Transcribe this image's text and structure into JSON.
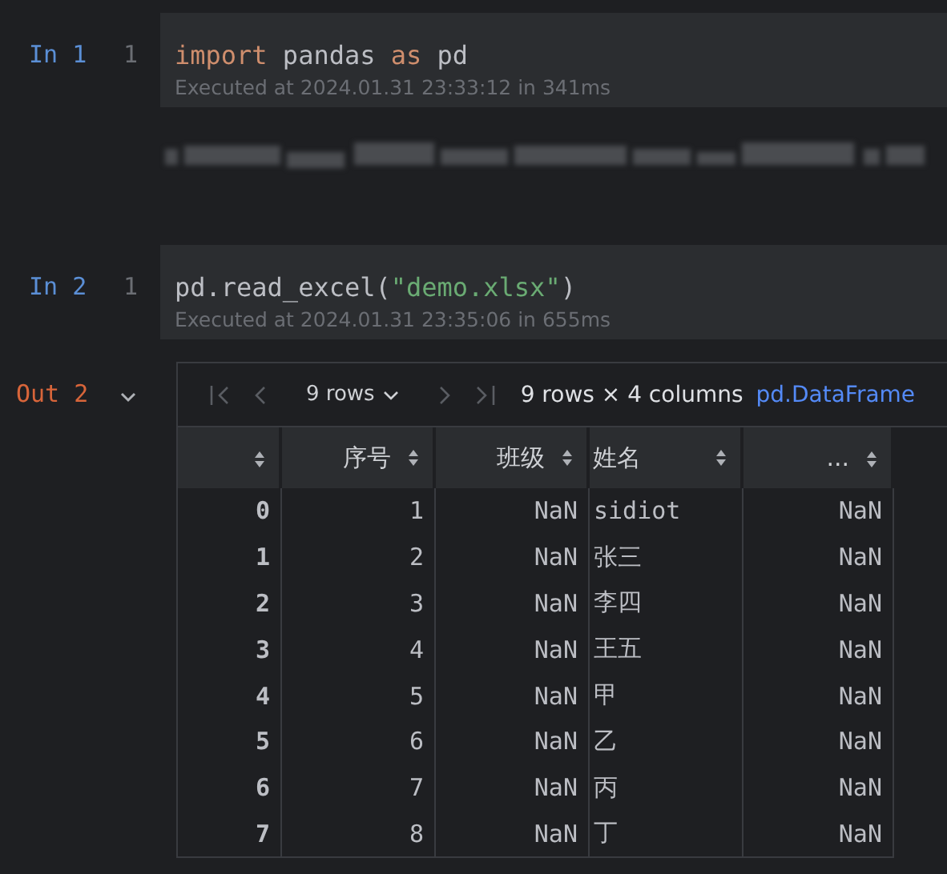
{
  "cells": [
    {
      "prompt": "In 1",
      "line_number": "1",
      "code": [
        {
          "kind": "keyword",
          "text": "import"
        },
        {
          "kind": "plain",
          "text": " pandas "
        },
        {
          "kind": "keyword",
          "text": "as"
        },
        {
          "kind": "plain",
          "text": " pd"
        }
      ],
      "status": "Executed at 2024.01.31 23:33:12 in 341ms",
      "output": {
        "kind": "blurred"
      }
    },
    {
      "prompt": "In 2",
      "line_number": "1",
      "code": [
        {
          "kind": "plain",
          "text": "pd.read_excel("
        },
        {
          "kind": "string",
          "text": "\"demo.xlsx\""
        },
        {
          "kind": "plain",
          "text": ")"
        }
      ],
      "status": "Executed at 2024.01.31 23:35:06 in 655ms"
    }
  ],
  "output": {
    "prompt": "Out 2",
    "expanded": true,
    "toolbar": {
      "nav": [
        {
          "kind": "first",
          "disabled": true
        },
        {
          "kind": "prev",
          "disabled": true
        }
      ],
      "rows_dropdown": "9 rows",
      "nav_after": [
        {
          "kind": "next",
          "disabled": true
        },
        {
          "kind": "last",
          "disabled": true
        }
      ],
      "shape": "9 rows × 4 columns",
      "type_link": "pd.DataFrame"
    },
    "table": {
      "columns": [
        "",
        "序号",
        "班级",
        "姓名",
        "..."
      ],
      "rows": [
        [
          "0",
          "1",
          "NaN",
          "sidiot",
          "NaN"
        ],
        [
          "1",
          "2",
          "NaN",
          "张三",
          "NaN"
        ],
        [
          "2",
          "3",
          "NaN",
          "李四",
          "NaN"
        ],
        [
          "3",
          "4",
          "NaN",
          "王五",
          "NaN"
        ],
        [
          "4",
          "5",
          "NaN",
          "甲",
          "NaN"
        ],
        [
          "5",
          "6",
          "NaN",
          "乙",
          "NaN"
        ],
        [
          "6",
          "7",
          "NaN",
          "丙",
          "NaN"
        ],
        [
          "7",
          "8",
          "NaN",
          "丁",
          "NaN"
        ]
      ]
    }
  }
}
